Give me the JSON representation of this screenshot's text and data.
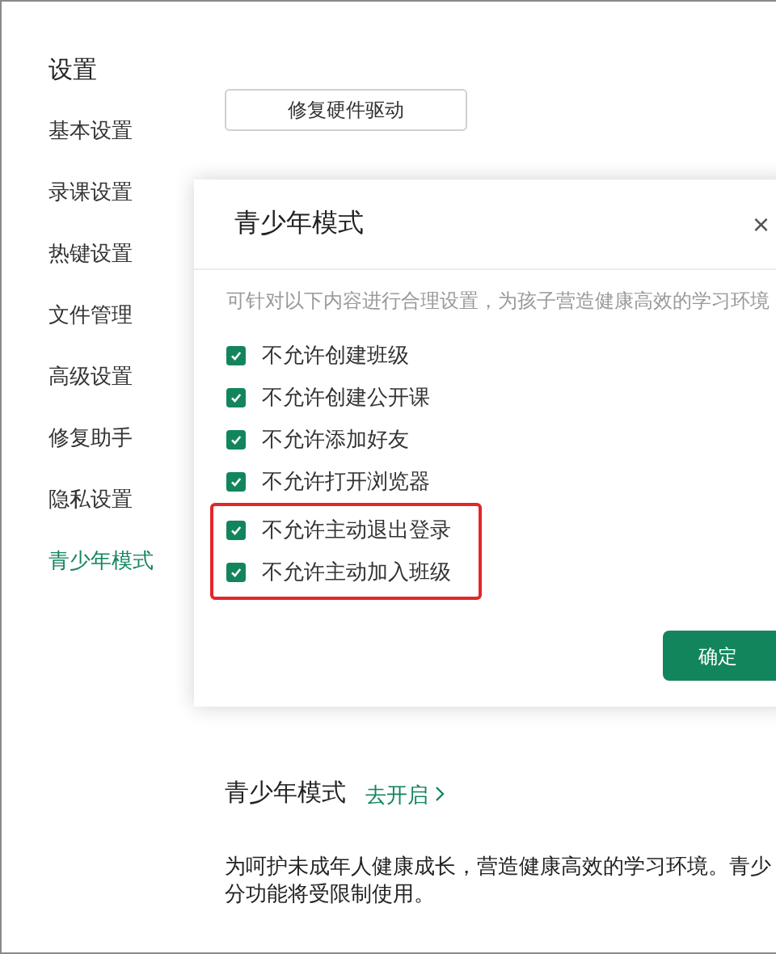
{
  "sidebar": {
    "title": "设置",
    "items": [
      {
        "label": "基本设置",
        "selected": false
      },
      {
        "label": "录课设置",
        "selected": false
      },
      {
        "label": "热键设置",
        "selected": false
      },
      {
        "label": "文件管理",
        "selected": false
      },
      {
        "label": "高级设置",
        "selected": false
      },
      {
        "label": "修复助手",
        "selected": false
      },
      {
        "label": "隐私设置",
        "selected": false
      },
      {
        "label": "青少年模式",
        "selected": true
      }
    ]
  },
  "repair_button": "修复硬件驱动",
  "dialog": {
    "title": "青少年模式",
    "close": "×",
    "description": "可针对以下内容进行合理设置，为孩子营造健康高效的学习环境",
    "options": [
      {
        "label": "不允许创建班级",
        "checked": true,
        "highlighted": false
      },
      {
        "label": "不允许创建公开课",
        "checked": true,
        "highlighted": false
      },
      {
        "label": "不允许添加好友",
        "checked": true,
        "highlighted": false
      },
      {
        "label": "不允许打开浏览器",
        "checked": true,
        "highlighted": false
      },
      {
        "label": "不允许主动退出登录",
        "checked": true,
        "highlighted": true
      },
      {
        "label": "不允许主动加入班级",
        "checked": true,
        "highlighted": true
      }
    ],
    "confirm": "确定"
  },
  "section": {
    "title": "青少年模式",
    "link": "去开启",
    "lines": [
      "为呵护未成年人健康成长，营造健康高效的学习环境。青少",
      "分功能将受限制使用。"
    ]
  }
}
